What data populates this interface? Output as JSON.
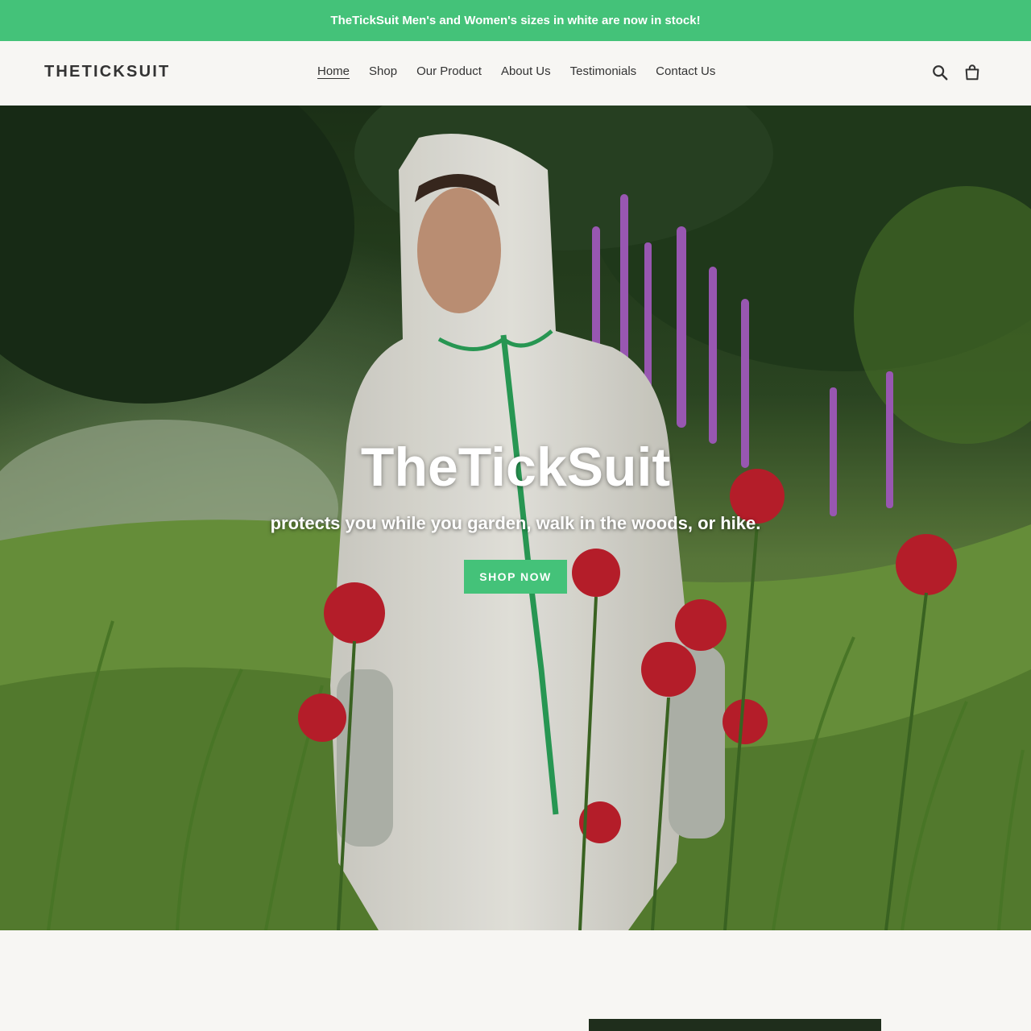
{
  "announcement": {
    "text": "TheTickSuit Men's and Women's sizes in white are now in stock!"
  },
  "header": {
    "logo": "THETICKSUIT",
    "nav": [
      {
        "label": "Home",
        "active": true
      },
      {
        "label": "Shop",
        "active": false
      },
      {
        "label": "Our Product",
        "active": false
      },
      {
        "label": "About Us",
        "active": false
      },
      {
        "label": "Testimonials",
        "active": false
      },
      {
        "label": "Contact Us",
        "active": false
      }
    ],
    "icons": [
      "search-icon",
      "cart-icon"
    ]
  },
  "hero": {
    "title": "TheTickSuit",
    "subtitle": "protects you while you garden, walk in the woods, or hike.",
    "button_label": "SHOP NOW"
  },
  "colors": {
    "accent": "#44c279",
    "text": "#333333",
    "background": "#f7f6f3"
  }
}
